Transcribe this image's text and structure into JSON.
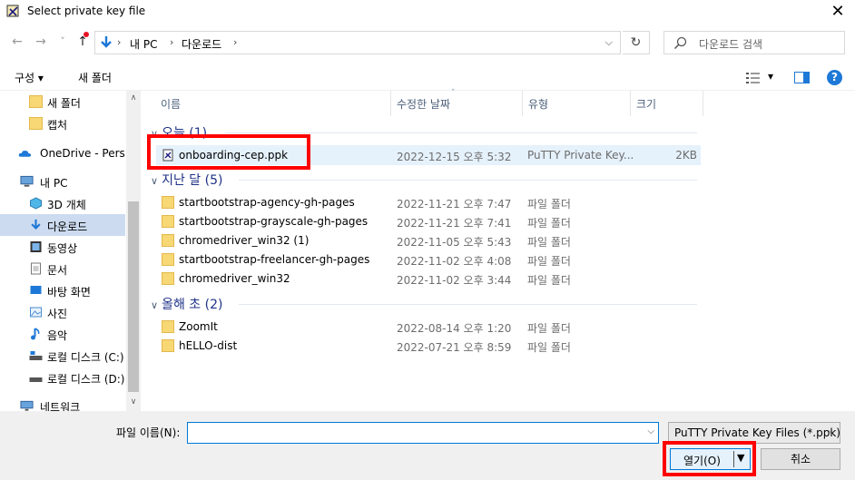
{
  "window": {
    "title": "Select private key file",
    "close_glyph": "✕"
  },
  "nav": {
    "back_glyph": "←",
    "forward_glyph": "→",
    "recent_glyph": "˅",
    "up_glyph": "↑",
    "address_segments": [
      "내 PC",
      "다운로드"
    ],
    "chevron_glyph": "›",
    "dropdown_glyph": "⌵",
    "refresh_glyph": "↻",
    "search_placeholder": "다운로드 검색"
  },
  "toolbar": {
    "organize": "구성 ▾",
    "new_folder": "새 폴더",
    "view_dd": "▾",
    "help": "?"
  },
  "sidebar": {
    "items": [
      {
        "label": "새 폴더",
        "icon": "folder-icon"
      },
      {
        "label": "캡처",
        "icon": "folder-icon"
      },
      {
        "label": "OneDrive - Personal",
        "icon": "cloud-icon"
      },
      {
        "label": "내 PC",
        "icon": "computer-icon"
      },
      {
        "label": "3D 개체",
        "icon": "cube-icon"
      },
      {
        "label": "다운로드",
        "icon": "download-icon"
      },
      {
        "label": "동영상",
        "icon": "video-icon"
      },
      {
        "label": "문서",
        "icon": "document-icon"
      },
      {
        "label": "바탕 화면",
        "icon": "desktop-icon"
      },
      {
        "label": "사진",
        "icon": "pictures-icon"
      },
      {
        "label": "음악",
        "icon": "music-icon"
      },
      {
        "label": "로컬 디스크 (C:)",
        "icon": "drive-icon"
      },
      {
        "label": "로컬 디스크 (D:)",
        "icon": "drive-icon"
      },
      {
        "label": "네트워크",
        "icon": "network-icon"
      }
    ],
    "scroll_up": "∧",
    "scroll_down": "∨"
  },
  "columns": {
    "name": "이름",
    "date": "수정한 날짜",
    "type": "유형",
    "size": "크기"
  },
  "groups": [
    {
      "title": "오늘 (1)",
      "files": [
        {
          "name": "onboarding-cep.ppk",
          "date": "2022-12-15 오후 5:32",
          "type": "PuTTY Private Key...",
          "size": "2KB",
          "icon": "putty-key-icon"
        }
      ]
    },
    {
      "title": "지난 달 (5)",
      "files": [
        {
          "name": "startbootstrap-agency-gh-pages",
          "date": "2022-11-21 오후 7:47",
          "type": "파일 폴더",
          "size": "",
          "icon": "folder-icon"
        },
        {
          "name": "startbootstrap-grayscale-gh-pages",
          "date": "2022-11-21 오후 7:41",
          "type": "파일 폴더",
          "size": "",
          "icon": "folder-icon"
        },
        {
          "name": "chromedriver_win32 (1)",
          "date": "2022-11-05 오후 5:43",
          "type": "파일 폴더",
          "size": "",
          "icon": "folder-icon"
        },
        {
          "name": "startbootstrap-freelancer-gh-pages",
          "date": "2022-11-02 오후 4:08",
          "type": "파일 폴더",
          "size": "",
          "icon": "folder-icon"
        },
        {
          "name": "chromedriver_win32",
          "date": "2022-11-02 오후 3:44",
          "type": "파일 폴더",
          "size": "",
          "icon": "folder-icon"
        }
      ]
    },
    {
      "title": "올해 초 (2)",
      "files": [
        {
          "name": "ZoomIt",
          "date": "2022-08-14 오후 1:20",
          "type": "파일 폴더",
          "size": "",
          "icon": "folder-icon"
        },
        {
          "name": "hELLO-dist",
          "date": "2022-07-21 오후 8:59",
          "type": "파일 폴더",
          "size": "",
          "icon": "folder-icon"
        }
      ]
    }
  ],
  "bottom": {
    "filename_label": "파일 이름(N):",
    "filename_value": "",
    "filetype": "PuTTY Private Key Files (*.ppk)",
    "open_label": "열기(O)",
    "cancel_label": "취소",
    "dd_glyph": "⌵",
    "open_dd_glyph": "▼"
  },
  "colors": {
    "selection": "#ccdbef",
    "highlight_box": "#ff0000",
    "group_header": "#1e3287",
    "accent": "#0078d7"
  }
}
